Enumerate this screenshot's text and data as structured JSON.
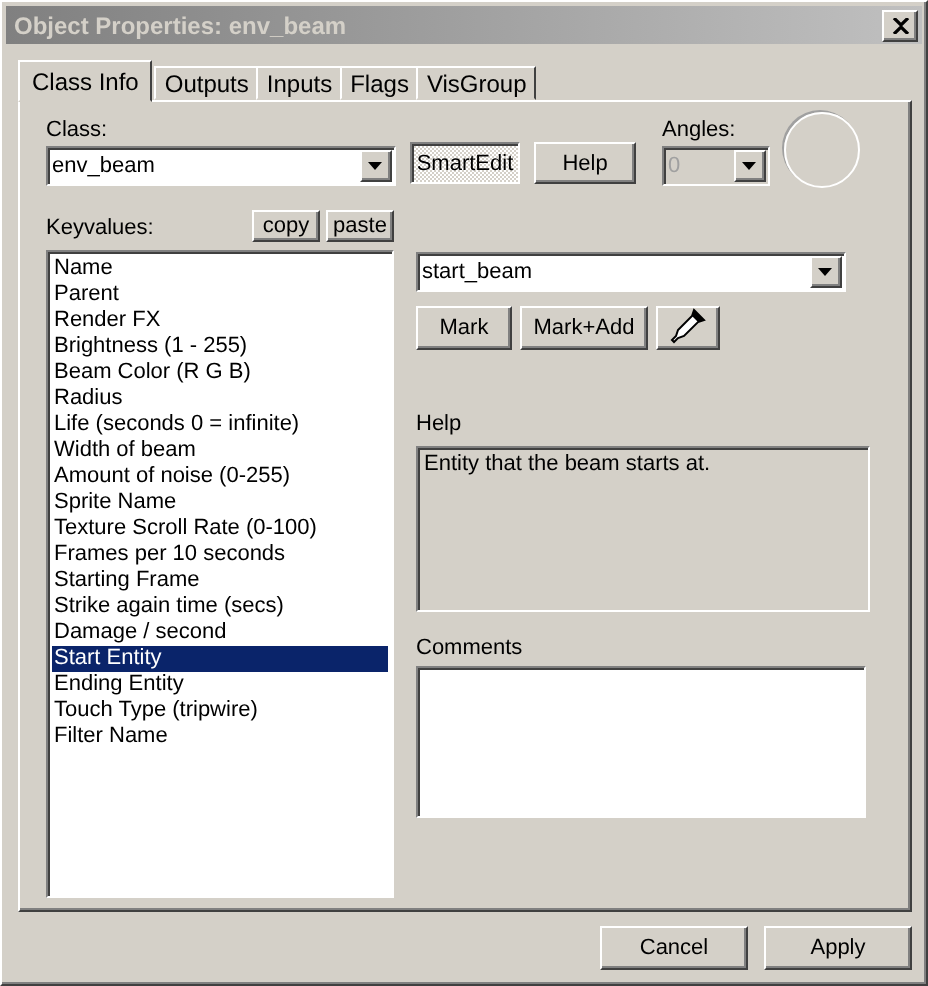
{
  "window": {
    "title": "Object Properties: env_beam"
  },
  "tabs": [
    {
      "label": "Class Info",
      "selected": true
    },
    {
      "label": "Outputs",
      "selected": false
    },
    {
      "label": "Inputs",
      "selected": false
    },
    {
      "label": "Flags",
      "selected": false
    },
    {
      "label": "VisGroup",
      "selected": false
    }
  ],
  "class": {
    "label": "Class:",
    "value": "env_beam"
  },
  "smart_edit": {
    "label": "SmartEdit",
    "pressed": true
  },
  "help_button": "Help",
  "angles": {
    "label": "Angles:",
    "value": "0",
    "disabled": true
  },
  "keyvalues": {
    "label": "Keyvalues:",
    "copy": "copy",
    "paste": "paste",
    "items": [
      {
        "label": "Name",
        "selected": false
      },
      {
        "label": "Parent",
        "selected": false
      },
      {
        "label": "Render FX",
        "selected": false
      },
      {
        "label": "Brightness (1 - 255)",
        "selected": false
      },
      {
        "label": "Beam Color (R G B)",
        "selected": false
      },
      {
        "label": "Radius",
        "selected": false
      },
      {
        "label": "Life (seconds 0 = infinite)",
        "selected": false
      },
      {
        "label": "Width of beam",
        "selected": false
      },
      {
        "label": "Amount of noise (0-255)",
        "selected": false
      },
      {
        "label": "Sprite Name",
        "selected": false
      },
      {
        "label": "Texture Scroll Rate (0-100)",
        "selected": false
      },
      {
        "label": "Frames per 10 seconds",
        "selected": false
      },
      {
        "label": "Starting Frame",
        "selected": false
      },
      {
        "label": "Strike again time (secs)",
        "selected": false
      },
      {
        "label": "Damage / second",
        "selected": false
      },
      {
        "label": "Start Entity",
        "selected": true
      },
      {
        "label": "Ending Entity",
        "selected": false
      },
      {
        "label": "Touch Type (tripwire)",
        "selected": false
      },
      {
        "label": "Filter Name",
        "selected": false
      }
    ]
  },
  "value": {
    "value": "start_beam",
    "mark": "Mark",
    "mark_add": "Mark+Add"
  },
  "help": {
    "label": "Help",
    "text": "Entity that the beam starts at."
  },
  "comments": {
    "label": "Comments"
  },
  "buttons": [
    "Cancel",
    "Apply"
  ]
}
